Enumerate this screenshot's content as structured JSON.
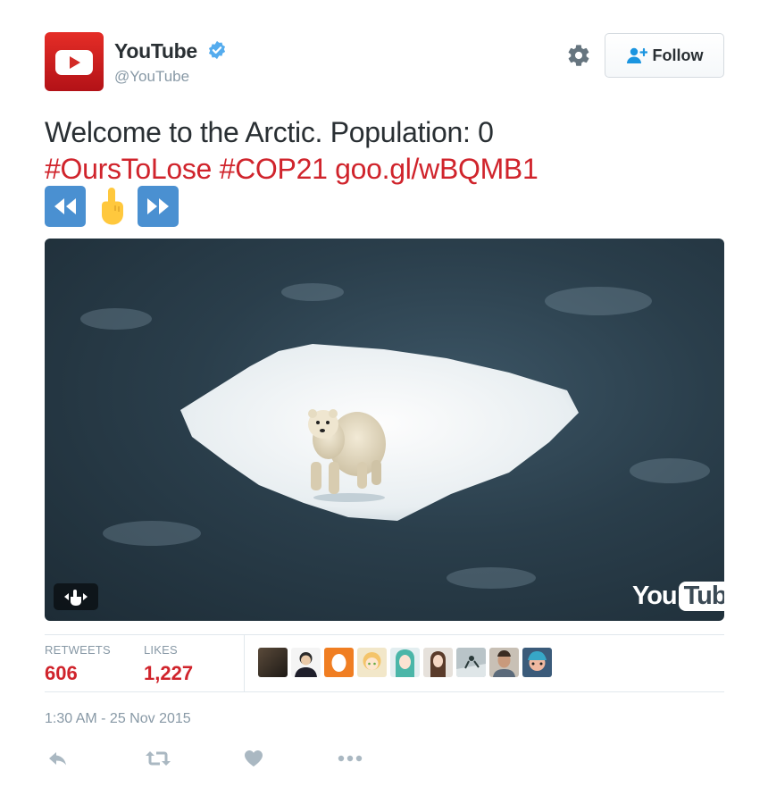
{
  "account": {
    "name": "YouTube",
    "handle": "@YouTube",
    "brand_color": "#e52d27",
    "verified_color": "#55acee"
  },
  "header": {
    "follow_label": "Follow",
    "settings_icon": "gear-icon"
  },
  "tweet": {
    "line1": "Welcome to the Arctic. Population: 0",
    "hashtag1": "#OursToLose",
    "hashtag2": "#COP21",
    "link": "goo.gl/wBQMB1",
    "link_color": "#d0242c",
    "emojis": [
      "rewind-icon",
      "pointing-up-hand-icon",
      "fast-forward-icon"
    ]
  },
  "media": {
    "watermark_you": "You",
    "watermark_tube": "Tube"
  },
  "stats": {
    "retweets_label": "RETWEETS",
    "retweets_value": "606",
    "likes_label": "LIKES",
    "likes_value": "1,227",
    "liker_avatar_count": 9
  },
  "timestamp": "1:30 AM - 25 Nov 2015",
  "actions": [
    "reply-icon",
    "retweet-icon",
    "like-icon",
    "more-icon"
  ]
}
